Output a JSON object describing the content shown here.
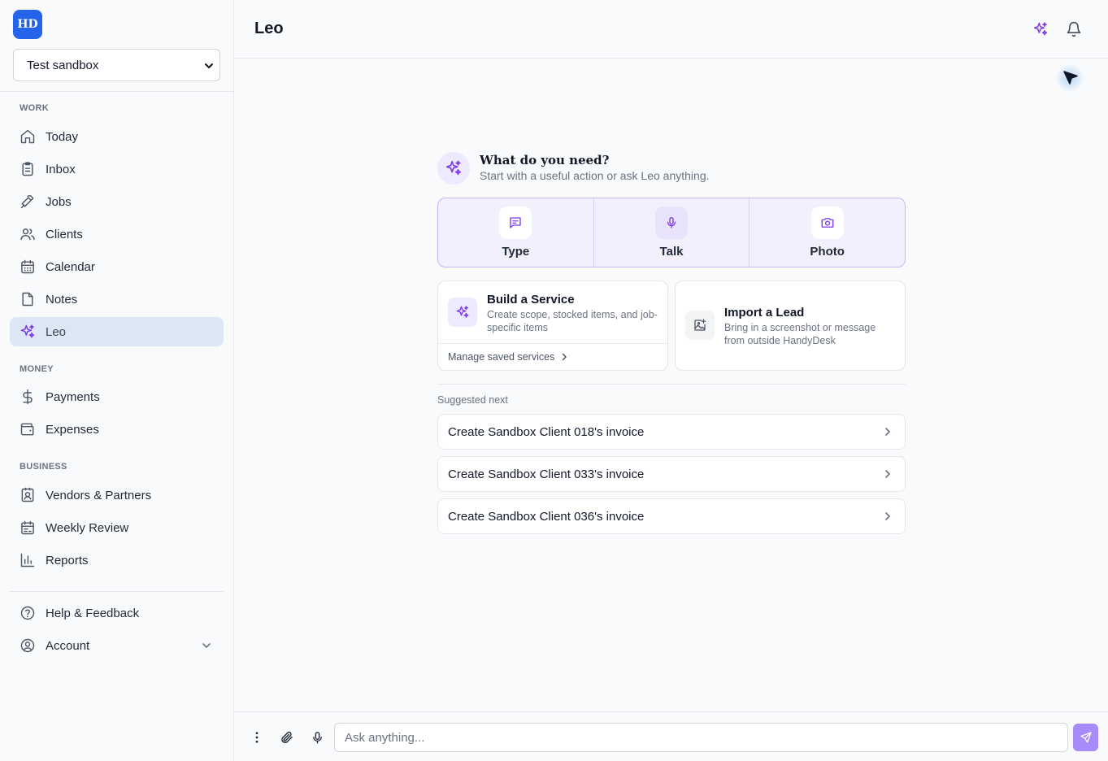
{
  "app": {
    "logo_text": "HD",
    "workspace": "Test sandbox"
  },
  "sidebar": {
    "sections": {
      "work": "WORK",
      "money": "MONEY",
      "business": "BUSINESS"
    },
    "items": {
      "today": "Today",
      "inbox": "Inbox",
      "jobs": "Jobs",
      "clients": "Clients",
      "calendar": "Calendar",
      "notes": "Notes",
      "leo": "Leo",
      "payments": "Payments",
      "expenses": "Expenses",
      "vendors": "Vendors & Partners",
      "weekly_review": "Weekly Review",
      "reports": "Reports",
      "help": "Help & Feedback",
      "account": "Account"
    },
    "active_item": "Leo"
  },
  "header": {
    "title": "Leo"
  },
  "main": {
    "intro_title": "What do you need?",
    "intro_subtitle": "Start with a useful action or ask Leo anything.",
    "modes": [
      "Type",
      "Talk",
      "Photo"
    ],
    "build_service": {
      "title": "Build a Service",
      "description": "Create scope, stocked items, and job-specific items",
      "footer": "Manage saved services"
    },
    "import_lead": {
      "title": "Import a Lead",
      "description": "Bring in a screenshot or message from outside HandyDesk"
    },
    "suggested_label": "Suggested next",
    "suggestions": [
      "Create Sandbox Client 018's invoice",
      "Create Sandbox Client 033's invoice",
      "Create Sandbox Client 036's invoice"
    ]
  },
  "composer": {
    "placeholder": "Ask anything..."
  },
  "colors": {
    "accent": "#7c3aed",
    "logo_bg": "#2563eb",
    "active_nav_bg": "#dce6f5",
    "send_button": "#a78bfa"
  }
}
